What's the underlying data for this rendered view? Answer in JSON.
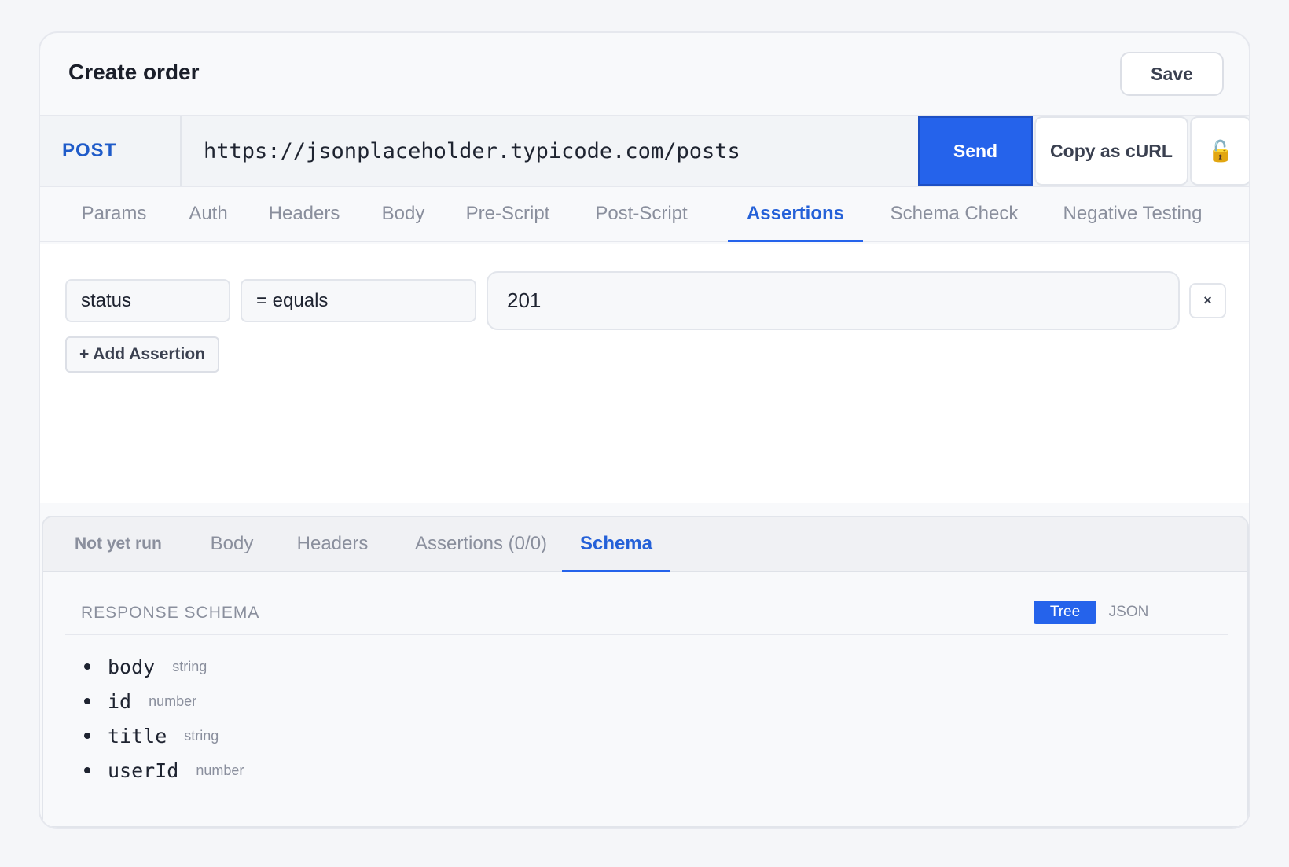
{
  "header": {
    "title": "Create order",
    "save_label": "Save"
  },
  "request": {
    "method": "POST",
    "url": "https://jsonplaceholder.typicode.com/posts",
    "send_label": "Send",
    "copy_curl_label": "Copy as cURL",
    "lock_icon": "🔓"
  },
  "tabs": [
    {
      "label": "Params"
    },
    {
      "label": "Auth"
    },
    {
      "label": "Headers"
    },
    {
      "label": "Body"
    },
    {
      "label": "Pre-Script"
    },
    {
      "label": "Post-Script"
    },
    {
      "label": "Assertions",
      "active": true
    },
    {
      "label": "Schema Check"
    },
    {
      "label": "Negative Testing"
    }
  ],
  "assertions": {
    "rows": [
      {
        "field": "status",
        "operator": "= equals",
        "value": "201",
        "remove_label": "×"
      }
    ],
    "add_label": "+ Add Assertion"
  },
  "response": {
    "status": "Not yet run",
    "tabs": [
      {
        "label": "Body"
      },
      {
        "label": "Headers"
      },
      {
        "label": "Assertions (0/0)"
      },
      {
        "label": "Schema",
        "active": true
      }
    ],
    "schema": {
      "title": "RESPONSE SCHEMA",
      "view_tree_label": "Tree",
      "view_json_label": "JSON",
      "properties": [
        {
          "name": "body",
          "type": "string"
        },
        {
          "name": "id",
          "type": "number"
        },
        {
          "name": "title",
          "type": "string"
        },
        {
          "name": "userId",
          "type": "number"
        }
      ]
    }
  },
  "colors": {
    "accent": "#2563eb",
    "method": "#1f5bc9",
    "muted": "#8a8f9d"
  }
}
